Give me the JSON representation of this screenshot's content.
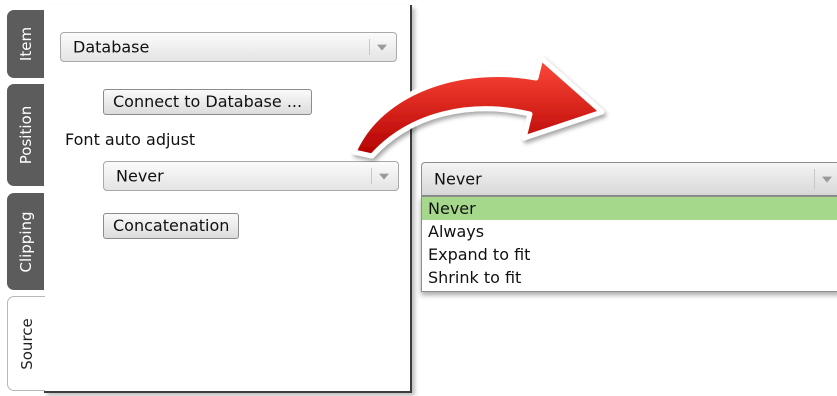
{
  "tabs": [
    {
      "label": "Item",
      "active": false
    },
    {
      "label": "Position",
      "active": false
    },
    {
      "label": "Clipping",
      "active": false
    },
    {
      "label": "Source",
      "active": true
    }
  ],
  "panel": {
    "source_select": {
      "value": "Database"
    },
    "connect_button": "Connect to Database ...",
    "font_auto_adjust_label": "Font auto adjust",
    "font_select": {
      "value": "Never"
    },
    "concatenation_button": "Concatenation"
  },
  "dropdown": {
    "value": "Never",
    "options": [
      "Never",
      "Always",
      "Expand to fit",
      "Shrink to fit"
    ],
    "selected_index": 0,
    "highlight_color": "#a6d88c"
  },
  "arrow_color": "#cc0d0d"
}
